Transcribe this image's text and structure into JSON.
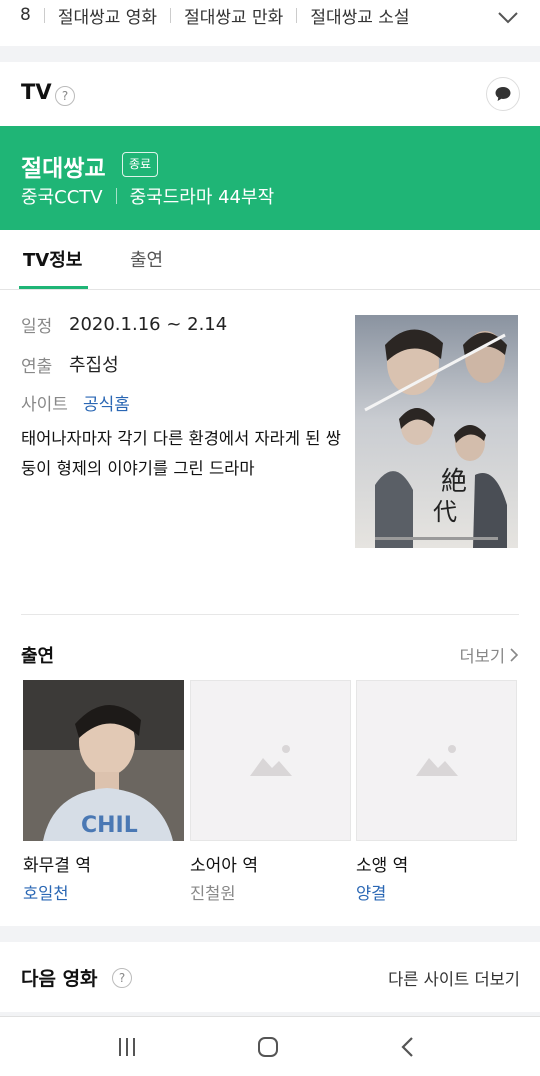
{
  "chips": {
    "partial": "8",
    "items": [
      "절대쌍교 영화",
      "절대쌍교 만화",
      "절대쌍교 소설"
    ]
  },
  "header": {
    "title": "TV",
    "help_symbol": "?"
  },
  "banner": {
    "title": "절대쌍교",
    "badge": "종료",
    "meta": [
      "중국CCTV",
      "중국드라마 44부작"
    ],
    "color": "#1fb576"
  },
  "tabs": [
    {
      "label": "TV정보",
      "active": true
    },
    {
      "label": "출연",
      "active": false
    }
  ],
  "info": {
    "schedule_label": "일정",
    "schedule_value": "2020.1.16 ~ 2.14",
    "director_label": "연출",
    "director_value": "추집성",
    "site_label": "사이트",
    "site_value": "공식홈",
    "synopsis": "태어나자마자 각기 다른 환경에서 자라게 된 쌍둥이 형제의 이야기를 그린 드라마"
  },
  "cast": {
    "title": "출연",
    "more_label": "더보기",
    "members": [
      {
        "role": "화무결 역",
        "name": "호일천",
        "has_photo": true,
        "linked": true
      },
      {
        "role": "소어아 역",
        "name": "진철원",
        "has_photo": false,
        "linked": false
      },
      {
        "role": "소앵 역",
        "name": "양결",
        "has_photo": false,
        "linked": true
      }
    ]
  },
  "next": {
    "title": "다음 영화",
    "help_symbol": "?",
    "more_label": "다른 사이트 더보기"
  },
  "colors": {
    "accent": "#1fb576",
    "link": "#2a67b4"
  },
  "icons": {
    "chips_toggle": "chevron-down-icon",
    "feedback": "chat-bubble-icon",
    "cast_placeholder": "image-placeholder-icon",
    "nav_recents": "recents-icon",
    "nav_home": "home-icon",
    "nav_back": "back-icon"
  }
}
